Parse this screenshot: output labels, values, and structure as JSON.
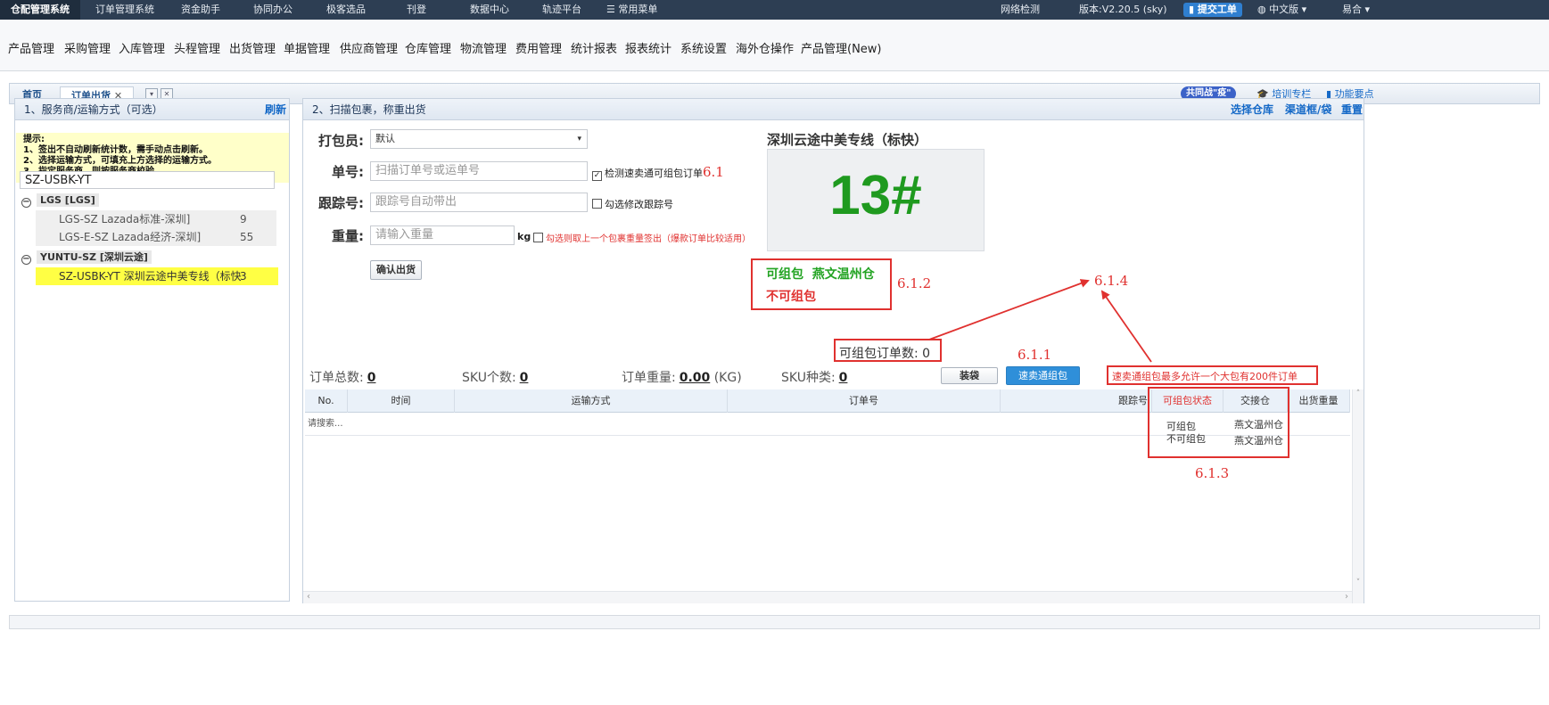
{
  "topbar": {
    "items": [
      "仓配管理系统",
      "订单管理系统",
      "资金助手",
      "协同办公",
      "极客选品",
      "刊登",
      "数据中心",
      "轨迹平台",
      "☰ 常用菜单"
    ],
    "network": "网络检测",
    "version": "版本:V2.20.5 (sky)",
    "ticket": "提交工单",
    "lang": "中文版 ▾",
    "user": "易合 ▾"
  },
  "menu": [
    "产品管理",
    "采购管理",
    "入库管理",
    "头程管理",
    "出货管理",
    "单据管理",
    "供应商管理",
    "仓库管理",
    "物流管理",
    "费用管理",
    "统计报表",
    "报表统计",
    "系统设置",
    "海外仓操作",
    "产品管理(New)"
  ],
  "tabs": {
    "home": "首页",
    "active": "订单出货",
    "close": "✕",
    "right_badge": "共同战\"疫\"",
    "training": "培训专栏",
    "features": "功能要点"
  },
  "left_panel": {
    "title": "1、服务商/运输方式（可选）",
    "refresh": "刷新",
    "tips": [
      "提示:",
      "1、签出不自动刷新统计数，需手动点击刷新。",
      "2、选择运输方式，可填充上方选择的运输方式。",
      "3、指定服务商，则按服务商校验。"
    ],
    "filter_value": "SZ-USBK-YT",
    "groups": [
      {
        "name": "LGS [LGS]",
        "rows": [
          {
            "label": "LGS-SZ Lazada标准-深圳]",
            "count": "9"
          },
          {
            "label": "LGS-E-SZ Lazada经济-深圳]",
            "count": "55"
          }
        ]
      },
      {
        "name": "YUNTU-SZ [深圳云途]",
        "rows": [
          {
            "label": "SZ-USBK-YT 深圳云途中美专线（标快",
            "count": "3"
          }
        ]
      }
    ]
  },
  "right_panel": {
    "title": "2、扫描包裹，称重出货",
    "links": [
      "选择仓库",
      "渠道框/袋",
      "重置"
    ],
    "packer_label": "打包员:",
    "packer_value": "默认",
    "order_label": "单号:",
    "order_placeholder": "扫描订单号或运单号",
    "detect_check": "检测速卖通可组包订单",
    "tracking_label": "跟踪号:",
    "tracking_placeholder": "跟踪号自动带出",
    "modify_tracking": "勾选修改跟踪号",
    "weight_label": "重量:",
    "weight_placeholder": "请输入重量",
    "unit": "kg",
    "weight_check": "勾选则取上一个包裹重量签出（爆款订单比较适用）",
    "confirm": "确认出货",
    "channel_title": "深圳云途中美专线（标快）",
    "bin": "13#",
    "pack_ok": "可组包",
    "warehouse_name": "燕文温州仓",
    "pack_no": "不可组包",
    "packable_count": "可组包订单数: 0",
    "stats": [
      {
        "label": "订单总数:",
        "value": "0",
        "unit": ""
      },
      {
        "label": "SKU个数:",
        "value": "0",
        "unit": ""
      },
      {
        "label": "订单重量:",
        "value": "0.00",
        "unit": "(KG)"
      },
      {
        "label": "SKU种类:",
        "value": "0",
        "unit": ""
      }
    ],
    "bag_btn": "装袋",
    "pack_btn": "速卖通组包",
    "columns": [
      "No.",
      "时间",
      "运输方式",
      "订单号",
      "跟踪号",
      "可组包状态",
      "交接仓",
      "出货重量"
    ],
    "empty_row": "请搜索...",
    "status_rows": [
      {
        "status": "可组包",
        "wh": "燕文温州仓"
      },
      {
        "status": "不可组包",
        "wh": "燕文温州仓"
      }
    ],
    "limit_note": "速卖通组包最多允许一个大包有200件订单"
  },
  "annotations": [
    "6.1",
    "6.1.2",
    "6.1.4",
    "6.1.1",
    "6.1.3"
  ],
  "colors": {
    "topbar": "#2d3e53",
    "accent": "#2f8fd9",
    "annotation": "#e0312f",
    "bin": "#1f9a1f",
    "ok_green": "#22a322"
  }
}
